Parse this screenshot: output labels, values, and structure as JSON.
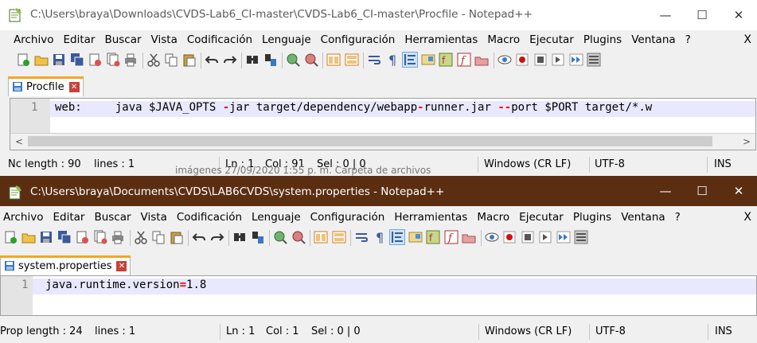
{
  "window1": {
    "title": "C:\\Users\\braya\\Downloads\\CVDS-Lab6_CI-master\\CVDS-Lab6_CI-master\\Procfile - Notepad++",
    "controls": {
      "minimize": "—",
      "maximize": "☐",
      "close": "✕"
    },
    "menu": [
      "Archivo",
      "Editar",
      "Buscar",
      "Vista",
      "Codificación",
      "Lenguaje",
      "Configuración",
      "Herramientas",
      "Macro",
      "Ejecutar",
      "Plugins",
      "Ventana",
      "?"
    ],
    "menu_close": "X",
    "tab": {
      "label": "Procfile",
      "close": "✕"
    },
    "editor": {
      "line_number": "1",
      "code_parts": [
        "web:     java $JAVA_OPTS ",
        "-",
        "jar target/dependency/webapp",
        "-",
        "runner.jar ",
        "--",
        "port $PORT target/*.w"
      ]
    },
    "hscroll": {
      "left": "<",
      "right": ">"
    },
    "status": {
      "length": "Nc length : 90",
      "lines": "lines : 1",
      "ln": "Ln : 1",
      "col": "Col : 91",
      "sel": "Sel : 0 | 0",
      "eol": "Windows (CR LF)",
      "encoding": "UTF-8",
      "mode": "INS"
    },
    "bleed_text": "imágenes                          27/09/2020 1:55 p. m.     Carpeta de archivos"
  },
  "window2": {
    "title": "C:\\Users\\braya\\Documents\\CVDS\\LAB6CVDS\\system.properties - Notepad++",
    "controls": {
      "minimize": "—",
      "maximize": "☐",
      "close": "✕"
    },
    "menu": [
      "Archivo",
      "Editar",
      "Buscar",
      "Vista",
      "Codificación",
      "Lenguaje",
      "Configuración",
      "Herramientas",
      "Macro",
      "Ejecutar",
      "Plugins",
      "Ventana",
      "?"
    ],
    "menu_close": "X",
    "tab": {
      "label": "system.properties",
      "close": "✕"
    },
    "editor": {
      "line_number": "1",
      "code_key": "java.runtime.version",
      "code_op": "=",
      "code_value": "1.8"
    },
    "status": {
      "length": "Prop length : 24",
      "lines": "lines : 1",
      "ln": "Ln : 1",
      "col": "Col : 1",
      "sel": "Sel : 0 | 0",
      "eol": "Windows (CR LF)",
      "encoding": "UTF-8",
      "mode": "INS"
    }
  },
  "toolbar_icons": [
    "new-file-icon",
    "open-file-icon",
    "save-icon",
    "save-all-icon",
    "close-icon",
    "close-all-icon",
    "print-icon",
    "cut-icon",
    "copy-icon",
    "paste-icon",
    "undo-icon",
    "redo-icon",
    "find-icon",
    "replace-icon",
    "zoom-in-icon",
    "zoom-out-icon",
    "sync-vertical-icon",
    "sync-horizontal-icon",
    "word-wrap-icon",
    "show-all-chars-icon",
    "indent-guide-icon",
    "doc-map-icon",
    "function-list-icon",
    "folder-workspace-icon",
    "monitoring-icon",
    "record-macro-icon",
    "stop-macro-icon",
    "play-macro-icon",
    "run-macro-multiple-icon",
    "save-macro-icon"
  ],
  "colors": {
    "accent_tab": "#f5a623",
    "title2_bg": "#5b2e12",
    "caret_line": "#e8e8ff",
    "operator": "#ff0000"
  }
}
